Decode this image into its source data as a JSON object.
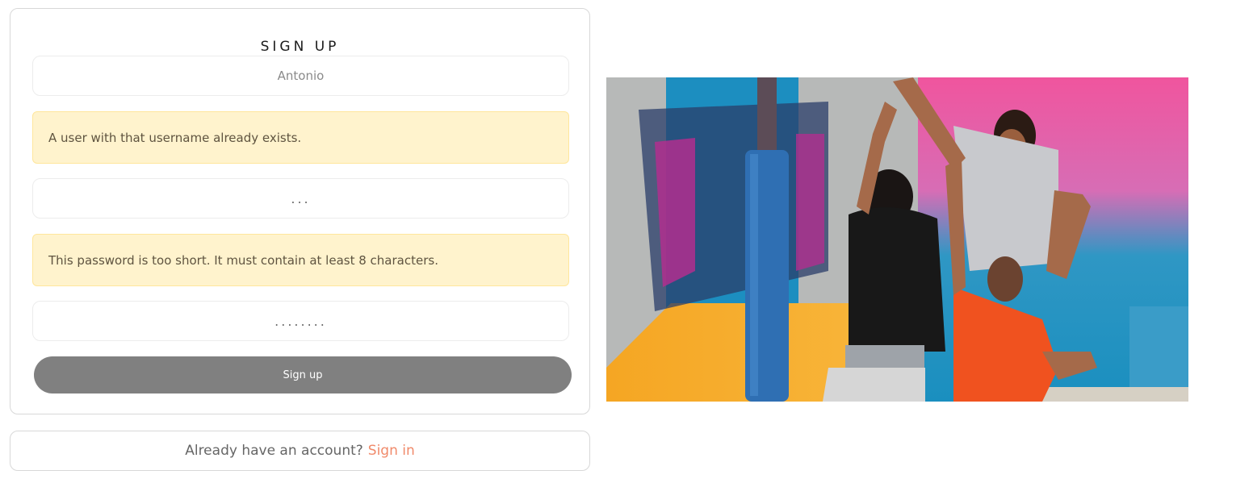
{
  "signup": {
    "title": "SIGN UP",
    "username_value": "Antonio",
    "username_error": "A user with that username already exists.",
    "password_value": "...",
    "password_error": "This password is too short. It must contain at least 8 characters.",
    "password_confirm_value": "........",
    "submit_label": "Sign up"
  },
  "signin_prompt": {
    "text": "Already have an account?",
    "link_label": "Sign in"
  },
  "colors": {
    "alert_bg": "#fff3cd",
    "button_bg": "#808080",
    "link": "#f08a6a"
  },
  "image": {
    "description_icon": "basketball-players-photo"
  }
}
